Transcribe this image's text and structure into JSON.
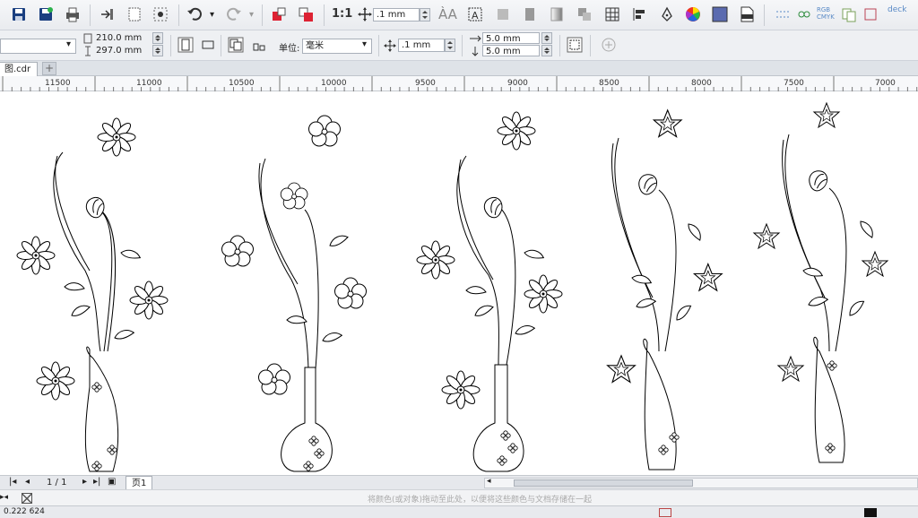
{
  "colors": {
    "accent": "#1f6fbf",
    "toolbar_bg": "#e9ebef",
    "canvas": "#ffffff",
    "palette_swatch": "#5b6bb0"
  },
  "toolbar1": {
    "zoom_value": ".1 mm",
    "icons": [
      "save-icon",
      "save-as-icon",
      "print-icon",
      "import-icon",
      "page-frame-icon",
      "snap-icon",
      "undo-icon",
      "redo-icon",
      "export-icon",
      "publish-icon",
      "zoom-1to1-icon",
      "nudge-icon",
      "text-icon",
      "text-frame-icon",
      "bitmap-icon",
      "gradient-icon",
      "transparency-icon",
      "grid-icon",
      "align-icon",
      "pen-icon",
      "color-wheel-icon",
      "fill-icon",
      "pdf-icon",
      "guides-icon",
      "dimension-icon",
      "rgb-cmyk-icon",
      "duplicate-icon",
      "dock-icon"
    ]
  },
  "toolbar2": {
    "paper_dropdown": "",
    "width": "210.0 mm",
    "height": "297.0 mm",
    "units_label": "单位:",
    "units_value": "毫米",
    "nudge": ".1 mm",
    "dup_x": "5.0 mm",
    "dup_y": "5.0 mm"
  },
  "tabs": [
    {
      "label": "图.cdr"
    }
  ],
  "ruler": {
    "ticks": [
      "11500",
      "11000",
      "10500",
      "10000",
      "9500",
      "9000",
      "8500",
      "8000",
      "7500",
      "7000"
    ]
  },
  "navbar": {
    "page_count": "1 / 1",
    "page_tab": "页1"
  },
  "palette": {
    "hint": "将颜色(或对象)拖动至此处，以便将这些颜色与文档存储在一起"
  },
  "statusbar": {
    "left": "0.222 624"
  }
}
